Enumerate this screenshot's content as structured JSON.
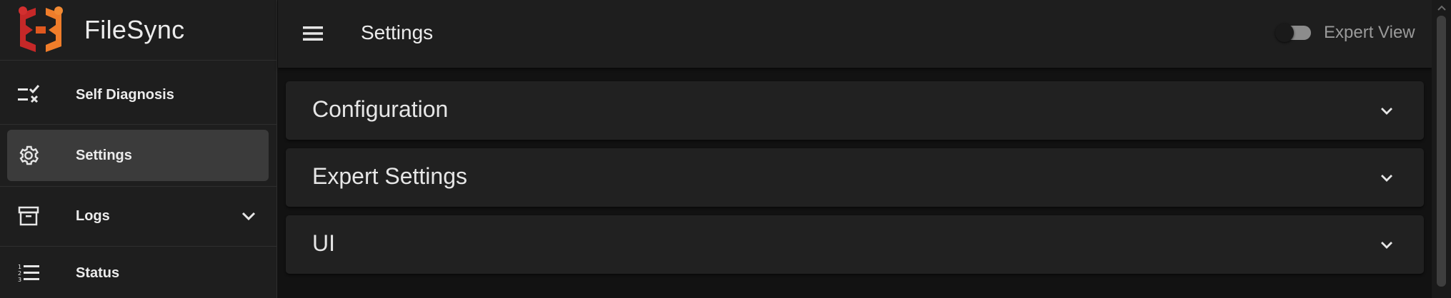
{
  "app": {
    "name": "FileSync"
  },
  "sidebar": {
    "items": [
      {
        "label": "Self Diagnosis",
        "icon": "checklist-icon"
      },
      {
        "label": "Settings",
        "icon": "gear-icon",
        "active": true
      },
      {
        "label": "Logs",
        "icon": "archive-icon",
        "expandable": true
      },
      {
        "label": "Status",
        "icon": "numbered-list-icon"
      }
    ]
  },
  "topbar": {
    "title": "Settings",
    "menu_icon": "hamburger-menu-icon",
    "expert_toggle": {
      "label": "Expert View",
      "checked": false
    }
  },
  "panels": [
    {
      "title": "Configuration",
      "expanded": false
    },
    {
      "title": "Expert Settings",
      "expanded": false
    },
    {
      "title": "UI",
      "expanded": false
    }
  ],
  "colors": {
    "background": "#121212",
    "surface": "#1e1e1e",
    "panel": "#212121",
    "active_item": "#3b3b3b",
    "logo_red": "#c62828",
    "logo_orange": "#f07d2a",
    "text": "#ececec",
    "muted_text": "#9a9a9a"
  }
}
